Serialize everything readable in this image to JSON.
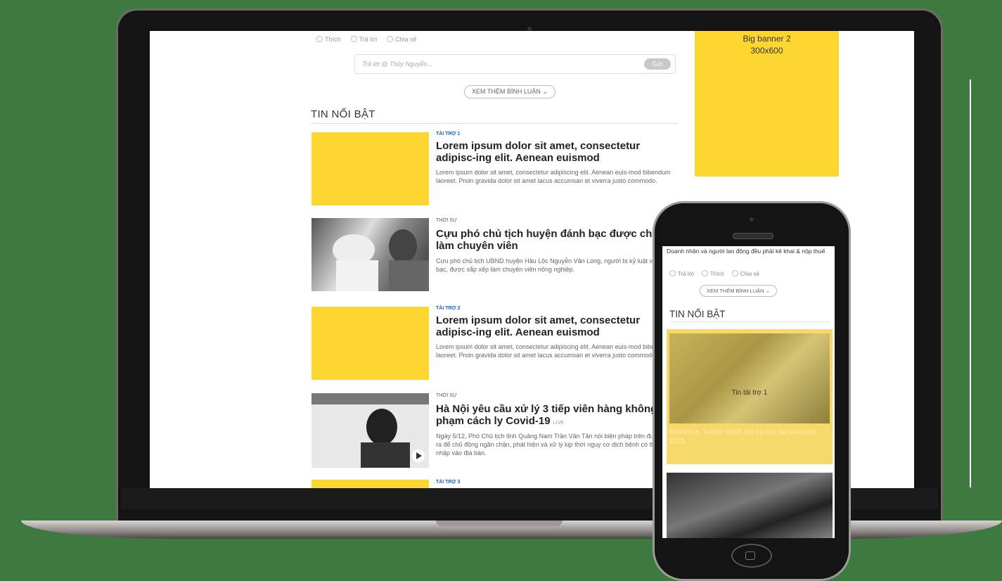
{
  "colors": {
    "background": "#3e7a40",
    "ad_yellow": "#fdd72f",
    "sponsor_blue": "#1565c0"
  },
  "laptop": {
    "reactions": [
      "Thích",
      "Trả lời",
      "Chia sẻ"
    ],
    "reply_placeholder": "Trả lời @ Thủy Nguyễn...",
    "reply_button": "Gửi",
    "more_comments": "XEM THÊM BÌNH LUẬN",
    "section_title": "TIN NỔI BẬT",
    "banner": {
      "line1": "Big banner 2",
      "line2": "300x600"
    },
    "articles": [
      {
        "category": "TÀI TRỢ 1",
        "title": "Lorem ipsum dolor sit amet, consectetur adipisc-ing elit. Aenean euismod",
        "summary": "Lorem ipsum dolor sit amet, consectetur adipiscing elit. Aenean euis-mod bibendum laoreet. Proin gravida dolor sit amet lacus accumsan et viverra justo commodo."
      },
      {
        "category": "THỜI SỰ",
        "title": "Cựu phó chủ tịch huyện đánh bạc được chuyển làm chuyên viên",
        "summary": "Cựu phó chủ tịch UBND huyện Hậu Lộc Nguyễn Văn Long, người bị kỷ luật vì đánh bạc, được sắp xếp làm chuyên viên nông nghiệp."
      },
      {
        "category": "TÀI TRỢ 2",
        "title": "Lorem ipsum dolor sit amet, consectetur adipisc-ing elit. Aenean euismod",
        "summary": "Lorem ipsum dolor sit amet, consectetur adipiscing elit. Aenean euis-mod bibendum laoreet. Proin gravida dolor sit amet lacus accumsan et viverra justo commodo."
      },
      {
        "category": "THỜI SỰ",
        "title": "Hà Nội yêu cầu xử lý 3 tiếp viên hàng không vi phạm cách ly Covid-19",
        "live": "LIVE",
        "summary": "Ngày 5/12, Phó Chủ tịch tỉnh Quảng Nam Trần Văn Tân nói biện pháp trên được đưa ra để chủ động ngăn chặn, phát hiện và xử lý kịp thời nguy cơ dịch bệnh có thể xâm nhập vào địa bàn."
      },
      {
        "category": "TÀI TRỢ 3"
      }
    ]
  },
  "phone": {
    "text": "Doanh nhân và người lao động đều phải kê khai & nộp thuế",
    "reactions": [
      "Trả lời",
      "Thích",
      "Chia sẻ"
    ],
    "more_comments": "XEM THÊM BÌNH LUẬN",
    "section_title": "TIN NỔI BẬT",
    "ad_label": "Tin tài trợ 1",
    "card_title": "Beyonce, Taylor Swift lập kỷ lục tại Grammy 2021"
  }
}
